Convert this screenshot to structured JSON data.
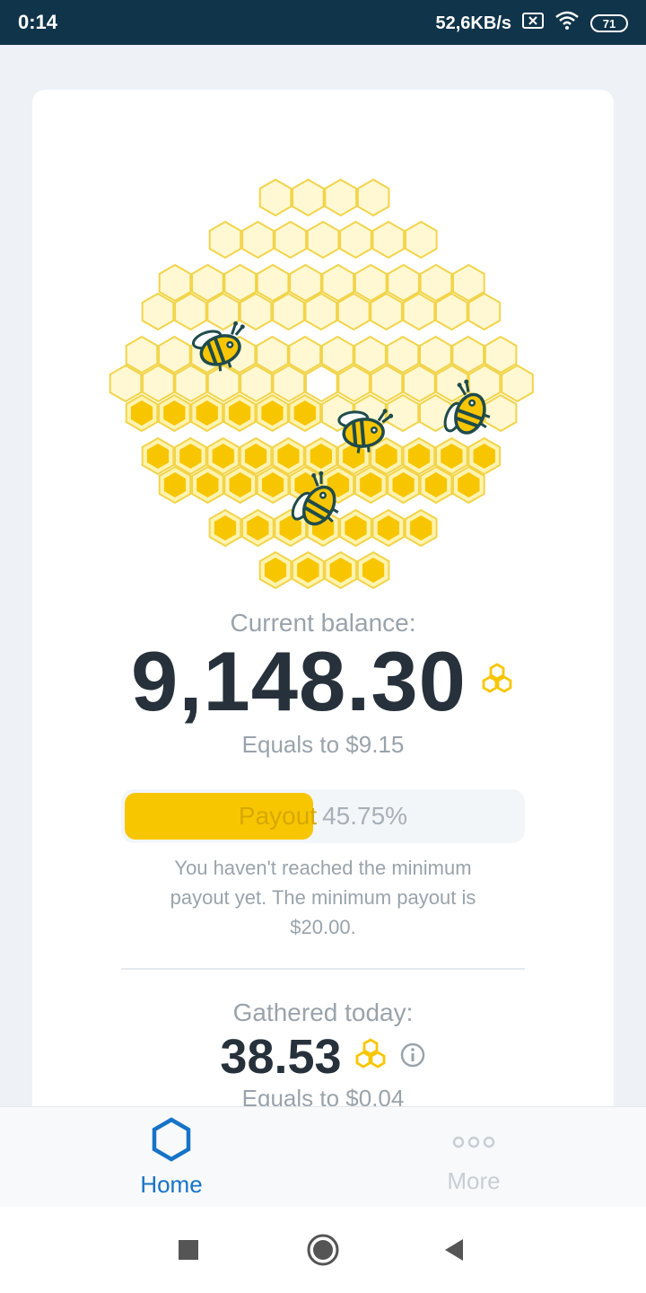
{
  "status_bar": {
    "time": "0:14",
    "network_speed": "52,6KB/s",
    "battery": "71"
  },
  "balance": {
    "label": "Current balance:",
    "value": "9,148.30",
    "equals": "Equals to $9.15"
  },
  "payout": {
    "label": "Payout",
    "percent_text": "45.75%",
    "progress_fraction": 0.4575,
    "note": "You haven't reached the minimum payout yet. The minimum payout is $20.00."
  },
  "today": {
    "label": "Gathered today:",
    "value": "38.53",
    "equals": "Equals to $0.04"
  },
  "bottom_nav": {
    "home": "Home",
    "more": "More"
  },
  "colors": {
    "honey": "#f8c600",
    "accent": "#1673c7",
    "statusbar": "#10344a"
  }
}
